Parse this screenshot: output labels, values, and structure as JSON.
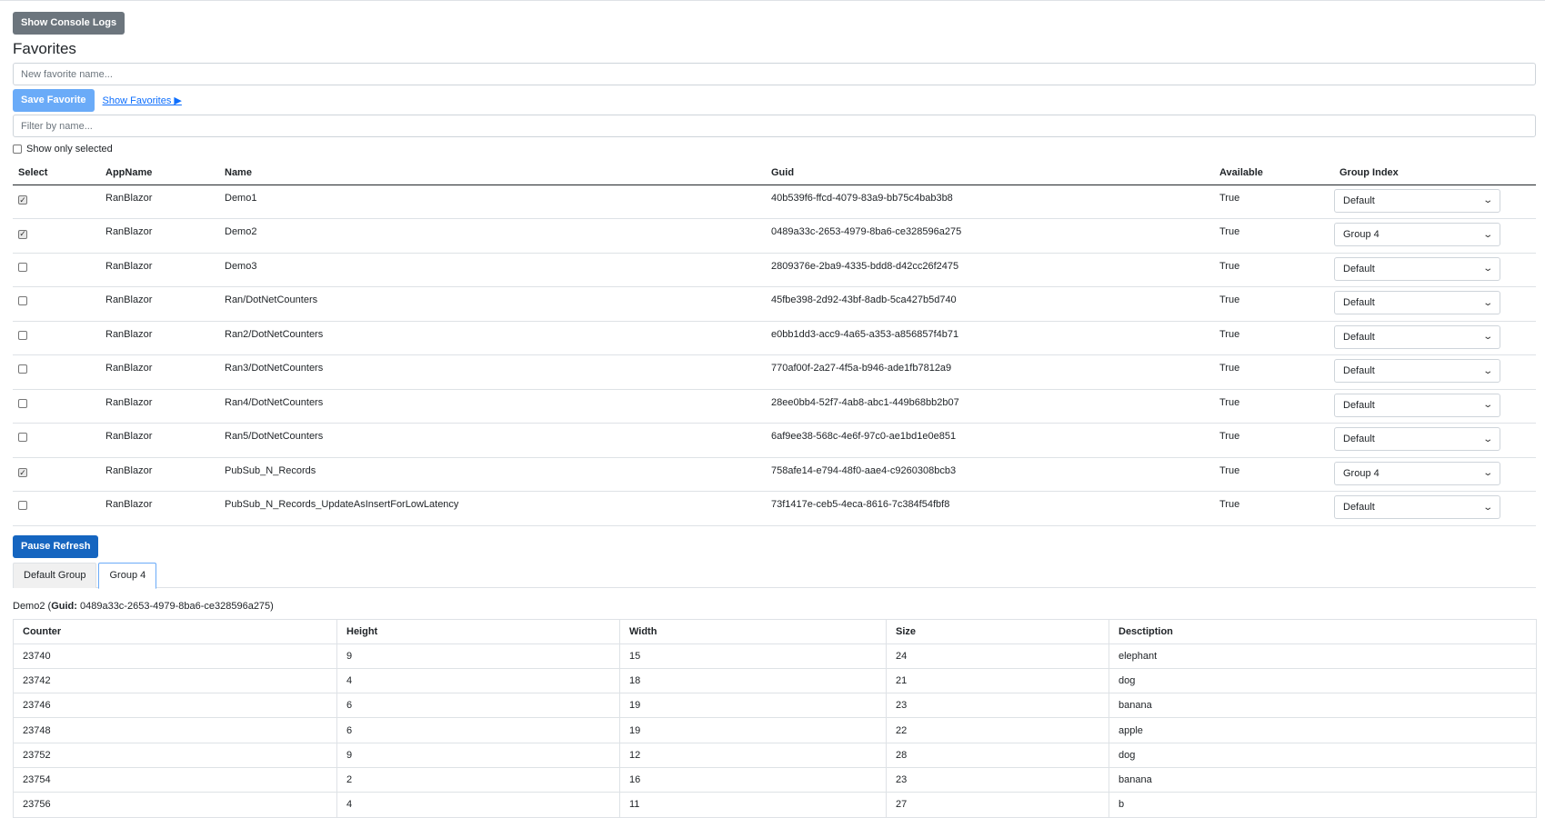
{
  "console_button": "Show Console Logs",
  "favorites": {
    "title": "Favorites",
    "name_placeholder": "New favorite name...",
    "save_label": "Save Favorite",
    "show_link": "Show Favorites ▶",
    "filter_placeholder": "Filter by name...",
    "show_selected_label": "Show only selected"
  },
  "main_table": {
    "headers": [
      "Select",
      "AppName",
      "Name",
      "Guid",
      "Available",
      "Group Index"
    ],
    "rows": [
      {
        "selected": true,
        "app": "RanBlazor",
        "name": "Demo1",
        "guid": "40b539f6-ffcd-4079-83a9-bb75c4bab3b8",
        "available": "True",
        "group": "Default"
      },
      {
        "selected": true,
        "app": "RanBlazor",
        "name": "Demo2",
        "guid": "0489a33c-2653-4979-8ba6-ce328596a275",
        "available": "True",
        "group": "Group 4"
      },
      {
        "selected": false,
        "app": "RanBlazor",
        "name": "Demo3",
        "guid": "2809376e-2ba9-4335-bdd8-d42cc26f2475",
        "available": "True",
        "group": "Default"
      },
      {
        "selected": false,
        "app": "RanBlazor",
        "name": "Ran/DotNetCounters",
        "guid": "45fbe398-2d92-43bf-8adb-5ca427b5d740",
        "available": "True",
        "group": "Default"
      },
      {
        "selected": false,
        "app": "RanBlazor",
        "name": "Ran2/DotNetCounters",
        "guid": "e0bb1dd3-acc9-4a65-a353-a856857f4b71",
        "available": "True",
        "group": "Default"
      },
      {
        "selected": false,
        "app": "RanBlazor",
        "name": "Ran3/DotNetCounters",
        "guid": "770af00f-2a27-4f5a-b946-ade1fb7812a9",
        "available": "True",
        "group": "Default"
      },
      {
        "selected": false,
        "app": "RanBlazor",
        "name": "Ran4/DotNetCounters",
        "guid": "28ee0bb4-52f7-4ab8-abc1-449b68bb2b07",
        "available": "True",
        "group": "Default"
      },
      {
        "selected": false,
        "app": "RanBlazor",
        "name": "Ran5/DotNetCounters",
        "guid": "6af9ee38-568c-4e6f-97c0-ae1bd1e0e851",
        "available": "True",
        "group": "Default"
      },
      {
        "selected": true,
        "app": "RanBlazor",
        "name": "PubSub_N_Records",
        "guid": "758afe14-e794-48f0-aae4-c9260308bcb3",
        "available": "True",
        "group": "Group 4"
      },
      {
        "selected": false,
        "app": "RanBlazor",
        "name": "PubSub_N_Records_UpdateAsInsertForLowLatency",
        "guid": "73f1417e-ceb5-4eca-8616-7c384f54fbf8",
        "available": "True",
        "group": "Default"
      }
    ]
  },
  "pause_button": "Pause Refresh",
  "tabs": [
    {
      "label": "Default Group",
      "active": false
    },
    {
      "label": "Group 4",
      "active": true
    }
  ],
  "details": {
    "name": "Demo2",
    "guid_label": "Guid:",
    "guid": "0489a33c-2653-4979-8ba6-ce328596a275"
  },
  "data_table": {
    "headers": [
      "Counter",
      "Height",
      "Width",
      "Size",
      "Desctiption"
    ],
    "rows": [
      [
        "23740",
        "9",
        "15",
        "24",
        "elephant"
      ],
      [
        "23742",
        "4",
        "18",
        "21",
        "dog"
      ],
      [
        "23746",
        "6",
        "19",
        "23",
        "banana"
      ],
      [
        "23748",
        "6",
        "19",
        "22",
        "apple"
      ],
      [
        "23752",
        "9",
        "12",
        "28",
        "dog"
      ],
      [
        "23754",
        "2",
        "16",
        "23",
        "banana"
      ],
      [
        "23756",
        "4",
        "11",
        "27",
        "b"
      ]
    ]
  }
}
